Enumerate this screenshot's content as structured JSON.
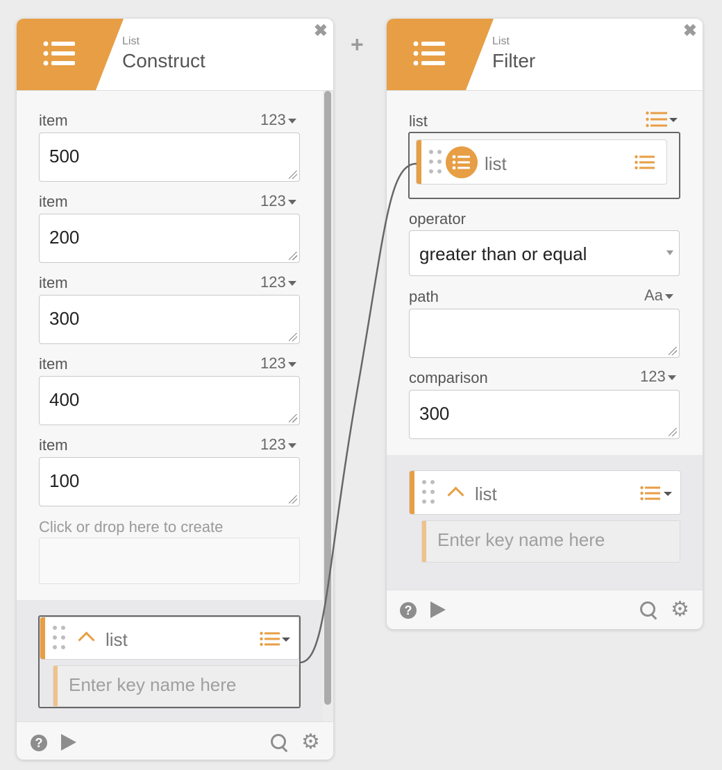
{
  "colors": {
    "accent": "#e79e44",
    "accent_light": "#efc28b",
    "wire": "#666666"
  },
  "add_node_label": "+",
  "construct": {
    "category": "List",
    "title": "Construct",
    "close_label": "✖",
    "fields": [
      {
        "label": "item",
        "type": "123",
        "value": "500"
      },
      {
        "label": "item",
        "type": "123",
        "value": "200"
      },
      {
        "label": "item",
        "type": "123",
        "value": "300"
      },
      {
        "label": "item",
        "type": "123",
        "value": "400"
      },
      {
        "label": "item",
        "type": "123",
        "value": "100"
      }
    ],
    "create_hint": "Click or drop here to create",
    "output": {
      "label": "list",
      "key_placeholder": "Enter key name here"
    }
  },
  "filter": {
    "category": "List",
    "title": "Filter",
    "close_label": "✖",
    "list_field": {
      "label": "list",
      "connected_label": "list"
    },
    "operator": {
      "label": "operator",
      "value": "greater than or equal"
    },
    "path": {
      "label": "path",
      "type": "Aa",
      "value": ""
    },
    "comparison": {
      "label": "comparison",
      "type": "123",
      "value": "300"
    },
    "output": {
      "label": "list",
      "key_placeholder": "Enter key name here"
    }
  },
  "footer": {
    "help_label": "?",
    "gear_label": "⚙"
  }
}
